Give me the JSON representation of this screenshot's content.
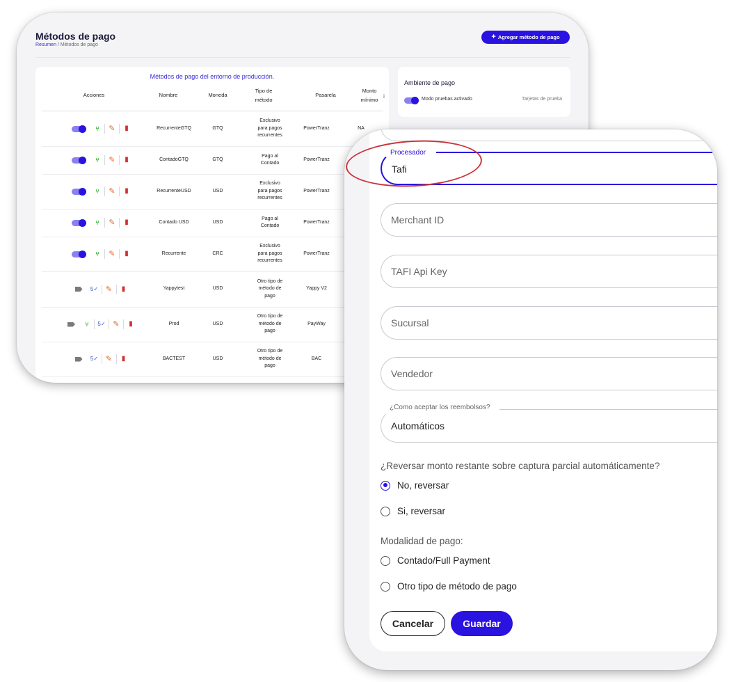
{
  "back": {
    "title": "Métodos de pago",
    "breadcrumb": {
      "home": "Resumen",
      "sep": "/",
      "current": "Métodos de pago"
    },
    "add_button": "Agregar método de pago",
    "table": {
      "caption": "Métodos de pago del entorno de producción.",
      "headers": {
        "acciones": "Acciones",
        "nombre": "Nombre",
        "moneda": "Moneda",
        "tipo": "Tipo de\nmétodo",
        "pasarela": "Pasarela",
        "monto": "Monto\nmínimo",
        "sort": "↓"
      },
      "rows": [
        {
          "nombre": "RecurrenteGTQ",
          "moneda": "GTQ",
          "tipo": "Exclusivo\npara pagos\nrecurrentes",
          "pasarela": "PowerTranz",
          "monto": "NA"
        },
        {
          "nombre": "ContadoGTQ",
          "moneda": "GTQ",
          "tipo": "Pago al\nContado",
          "pasarela": "PowerTranz",
          "monto": ""
        },
        {
          "nombre": "RecurrenteUSD",
          "moneda": "USD",
          "tipo": "Exclusivo\npara pagos\nrecurrentes",
          "pasarela": "PowerTranz",
          "monto": ""
        },
        {
          "nombre": "Contado USD",
          "moneda": "USD",
          "tipo": "Pago al\nContado",
          "pasarela": "PowerTranz",
          "monto": ""
        },
        {
          "nombre": "Recurrente",
          "moneda": "CRC",
          "tipo": "Exclusivo\npara pagos\nrecurrentes",
          "pasarela": "PowerTranz",
          "monto": ""
        },
        {
          "nombre": "Yappytest",
          "moneda": "USD",
          "tipo": "Otro tipo de\nmétodo de\npago",
          "pasarela": "Yappy V2",
          "monto": ""
        },
        {
          "nombre": "Prod",
          "moneda": "USD",
          "tipo": "Otro tipo de\nmétodo de\npago",
          "pasarela": "PayWay",
          "monto": ""
        },
        {
          "nombre": "BACTEST",
          "moneda": "USD",
          "tipo": "Otro tipo de\nmétodo de\npago",
          "pasarela": "BAC",
          "monto": ""
        }
      ]
    },
    "env": {
      "title": "Ambiente de pago",
      "toggle_label": "Modo pruebas activado",
      "link": "Tarjetas de prueba"
    }
  },
  "form": {
    "procesador": {
      "label": "Procesador",
      "value": "Tafi"
    },
    "merchant_id": {
      "placeholder": "Merchant ID"
    },
    "api_key": {
      "placeholder": "TAFI Api Key"
    },
    "sucursal": {
      "placeholder": "Sucursal"
    },
    "vendedor": {
      "placeholder": "Vendedor"
    },
    "reembolsos": {
      "label": "¿Como aceptar los reembolsos?",
      "value": "Automáticos"
    },
    "reversar_question": "¿Reversar monto restante sobre captura parcial automáticamente?",
    "reversar_options": [
      {
        "label": "No, reversar",
        "checked": true
      },
      {
        "label": "Si, reversar",
        "checked": false
      }
    ],
    "modalidad_question": "Modalidad de pago:",
    "modalidad_options": [
      {
        "label": "Contado/Full Payment",
        "checked": false
      },
      {
        "label": "Otro tipo de método de pago",
        "checked": false
      }
    ],
    "cancel": "Cancelar",
    "save": "Guardar"
  },
  "colors": {
    "accent": "#2a12e0",
    "highlight": "#c9363b"
  },
  "icons": {
    "branch": "branch-icon",
    "edit": "pencil-icon",
    "trash": "trash-icon",
    "tag": "tag-icon",
    "five": "refund-icon"
  }
}
